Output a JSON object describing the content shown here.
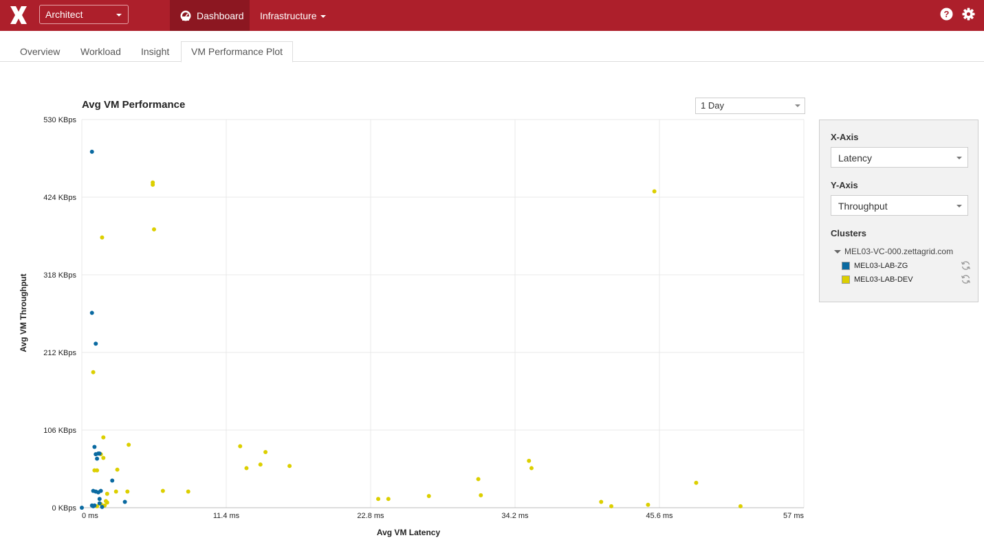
{
  "header": {
    "product": "Architect",
    "nav_dashboard": "Dashboard",
    "nav_infrastructure": "Infrastructure"
  },
  "tabs": [
    {
      "label": "Overview"
    },
    {
      "label": "Workload"
    },
    {
      "label": "Insight"
    },
    {
      "label": "VM Performance Plot"
    }
  ],
  "time_range": "1 Day",
  "panel": {
    "x_axis_label": "X-Axis",
    "x_axis_value": "Latency",
    "y_axis_label": "Y-Axis",
    "y_axis_value": "Throughput",
    "clusters_label": "Clusters",
    "vcenter": "MEL03-VC-000.zettagrid.com",
    "clusters": [
      {
        "name": "MEL03-LAB-ZG",
        "color": "#0a6aa1"
      },
      {
        "name": "MEL03-LAB-DEV",
        "color": "#dccf00"
      }
    ]
  },
  "chart_data": {
    "type": "scatter",
    "title": "Avg VM Performance",
    "xlabel": "Avg VM Latency",
    "ylabel": "Avg VM Throughput",
    "xlim": [
      0,
      57
    ],
    "ylim": [
      0,
      530
    ],
    "x_ticks": [
      "0 ms",
      "11.4 ms",
      "22.8 ms",
      "34.2 ms",
      "45.6 ms",
      "57 ms"
    ],
    "y_ticks": [
      "0 KBps",
      "106 KBps",
      "212 KBps",
      "318 KBps",
      "424 KBps",
      "530 KBps"
    ],
    "grid": true,
    "series": [
      {
        "name": "MEL03-LAB-ZG",
        "color": "#0a6aa1",
        "points": [
          [
            0.8,
            486
          ],
          [
            0.8,
            266
          ],
          [
            1.1,
            224
          ],
          [
            1.0,
            83
          ],
          [
            1.1,
            73
          ],
          [
            1.2,
            67
          ],
          [
            1.3,
            74
          ],
          [
            1.4,
            74
          ],
          [
            0.9,
            23
          ],
          [
            1.1,
            22
          ],
          [
            1.3,
            21
          ],
          [
            1.5,
            23
          ],
          [
            2.4,
            37
          ],
          [
            3.4,
            8
          ],
          [
            1.4,
            12
          ],
          [
            0.8,
            3
          ],
          [
            0.9,
            2
          ],
          [
            1.0,
            3
          ],
          [
            1.4,
            6
          ],
          [
            0.0,
            0
          ],
          [
            1.6,
            1
          ]
        ]
      },
      {
        "name": "MEL03-LAB-DEV",
        "color": "#dccf00",
        "points": [
          [
            5.6,
            444
          ],
          [
            5.6,
            441
          ],
          [
            5.7,
            380
          ],
          [
            1.6,
            369
          ],
          [
            0.9,
            185
          ],
          [
            1.7,
            96
          ],
          [
            3.7,
            86
          ],
          [
            1.5,
            73
          ],
          [
            1.7,
            68
          ],
          [
            1.0,
            51
          ],
          [
            1.2,
            51
          ],
          [
            2.8,
            52
          ],
          [
            3.6,
            22
          ],
          [
            2.7,
            22
          ],
          [
            2.0,
            19
          ],
          [
            6.4,
            23
          ],
          [
            8.4,
            22
          ],
          [
            1.9,
            9
          ],
          [
            2.0,
            7
          ],
          [
            1.5,
            5
          ],
          [
            1.8,
            3
          ],
          [
            1.2,
            2
          ],
          [
            12.5,
            84
          ],
          [
            13.0,
            54
          ],
          [
            14.1,
            59
          ],
          [
            14.5,
            76
          ],
          [
            16.4,
            57
          ],
          [
            23.4,
            12
          ],
          [
            24.2,
            12
          ],
          [
            27.4,
            16
          ],
          [
            31.3,
            39
          ],
          [
            31.5,
            17
          ],
          [
            35.3,
            64
          ],
          [
            35.5,
            54
          ],
          [
            41.0,
            8
          ],
          [
            41.8,
            2
          ],
          [
            44.7,
            4
          ],
          [
            45.2,
            432
          ],
          [
            48.5,
            34
          ],
          [
            52.0,
            2
          ]
        ]
      }
    ]
  }
}
